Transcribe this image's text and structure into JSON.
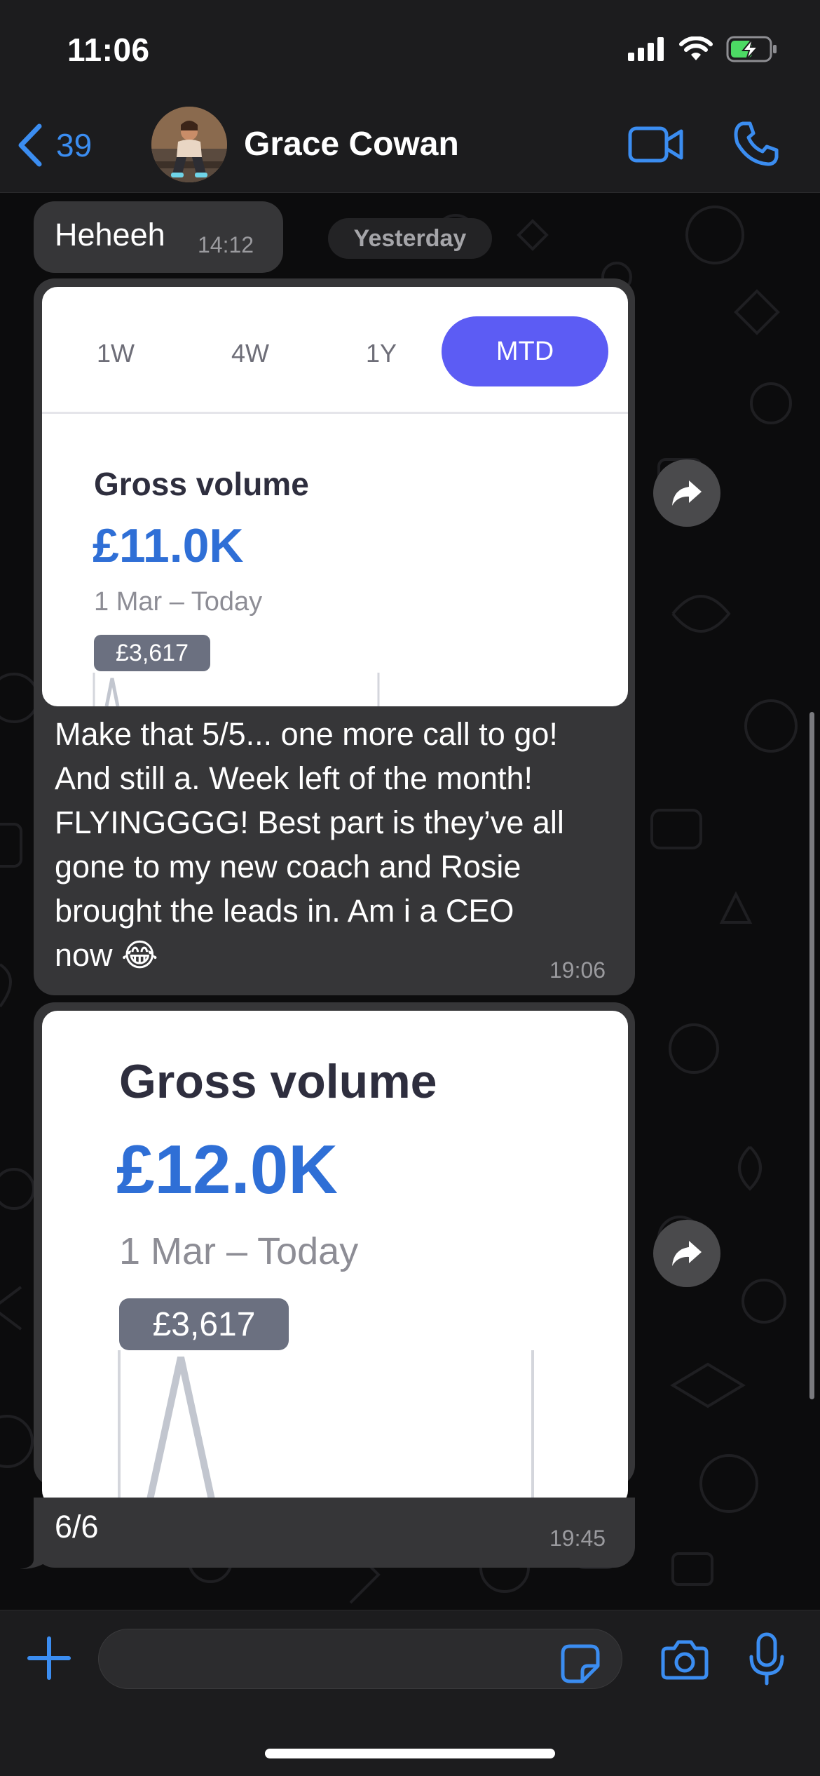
{
  "status_bar": {
    "time": "11:06"
  },
  "header": {
    "back_count": "39",
    "contact_name": "Grace Cowan"
  },
  "chat": {
    "date_separator": "Yesterday",
    "messages": [
      {
        "text": "Heheeh",
        "time": "14:12"
      },
      {
        "image": {
          "tabs": [
            "1W",
            "4W",
            "1Y",
            "MTD"
          ],
          "active_tab": "MTD",
          "title": "Gross volume",
          "amount": "£11.0K",
          "date_range": "1 Mar – Today",
          "tooltip_value": "£3,617"
        },
        "text_lines": [
          "Make that 5/5... one more call to go!",
          "And still a. Week left of the month!",
          "FLYINGGGG! Best part is they’ve all",
          "gone to my new coach and Rosie",
          "brought the leads in. Am i a CEO",
          "now 😂"
        ],
        "time": "19:06"
      },
      {
        "image": {
          "title": "Gross volume",
          "amount": "£12.0K",
          "date_range": "1 Mar – Today",
          "tooltip_value": "£3,617"
        },
        "text": "6/6",
        "time": "19:45"
      }
    ]
  },
  "colors": {
    "accent": "#3b8df1",
    "bubble": "#363638",
    "active_tab": "#5c5cf4",
    "amount": "#2f6fd6"
  }
}
